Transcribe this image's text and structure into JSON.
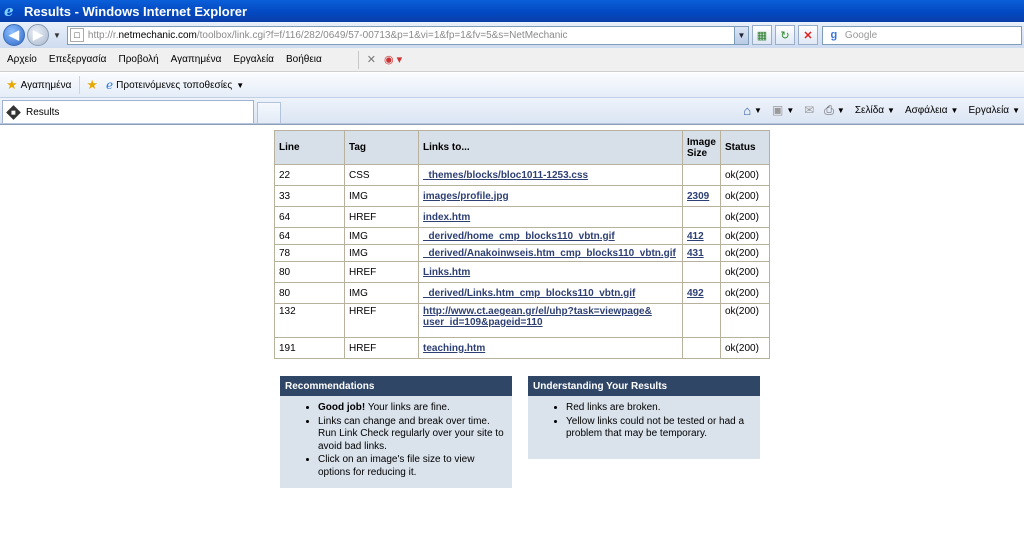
{
  "window": {
    "title": "Results - Windows Internet Explorer"
  },
  "address": {
    "url_prefix": "http://r.",
    "url_domain": "netmechanic.com",
    "url_rest": "/toolbox/link.cgi?f=f/116/282/0649/57-00713&p=1&vi=1&fp=1&fv=5&s=NetMechanic",
    "search_placeholder": "Google"
  },
  "menu": [
    "Αρχείο",
    "Επεξεργασία",
    "Προβολή",
    "Αγαπημένα",
    "Εργαλεία",
    "Βοήθεια"
  ],
  "favorites": {
    "label": "Αγαπημένα",
    "suggested": "Προτεινόμενες τοποθεσίες"
  },
  "tab": {
    "title": "Results"
  },
  "commands": {
    "page": "Σελίδα",
    "safety": "Ασφάλεια",
    "tools": "Εργαλεία"
  },
  "table": {
    "headers": [
      "Line",
      "Tag",
      "Links to...",
      "Image Size",
      "Status"
    ],
    "rows": [
      {
        "line": "22",
        "tag": "CSS",
        "link": "_themes/blocks/bloc1011-1253.css",
        "size": "",
        "status": "ok(200)"
      },
      {
        "line": "33",
        "tag": "IMG",
        "link": "images/profile.jpg",
        "size": "2309",
        "status": "ok(200)"
      },
      {
        "line": "64",
        "tag": "HREF",
        "link": "index.htm",
        "size": "",
        "status": "ok(200)"
      },
      {
        "line": "64",
        "tag": "IMG",
        "link": "_derived/home_cmp_blocks110_vbtn.gif",
        "size": "412",
        "status": "ok(200)"
      },
      {
        "line": "78",
        "tag": "IMG",
        "link": "_derived/Anakoinwseis.htm_cmp_blocks110_vbtn.gif",
        "size": "431",
        "status": "ok(200)"
      },
      {
        "line": "80",
        "tag": "HREF",
        "link": "Links.htm",
        "size": "",
        "status": "ok(200)"
      },
      {
        "line": "80",
        "tag": "IMG",
        "link": "_derived/Links.htm_cmp_blocks110_vbtn.gif",
        "size": "492",
        "status": "ok(200)"
      },
      {
        "line": "132",
        "tag": "HREF",
        "link1": "http://www.ct.aegean.gr/el/uhp?task=viewpage&",
        "link2": "user_id=109&pageid=110",
        "size": "",
        "status": "ok(200)"
      },
      {
        "line": "191",
        "tag": "HREF",
        "link": "teaching.htm",
        "size": "",
        "status": "ok(200)"
      }
    ]
  },
  "recommendations": {
    "title": "Recommendations",
    "item1_bold": "Good job!",
    "item1_rest": " Your links are fine.",
    "item2": "Links can change and break over time. Run Link Check regularly over your site to avoid bad links.",
    "item3": "Click on an image's file size to view options for reducing it."
  },
  "understanding": {
    "title": "Understanding Your Results",
    "item1": "Red links are broken.",
    "item2": "Yellow links could not be tested or had a problem that may be temporary."
  }
}
